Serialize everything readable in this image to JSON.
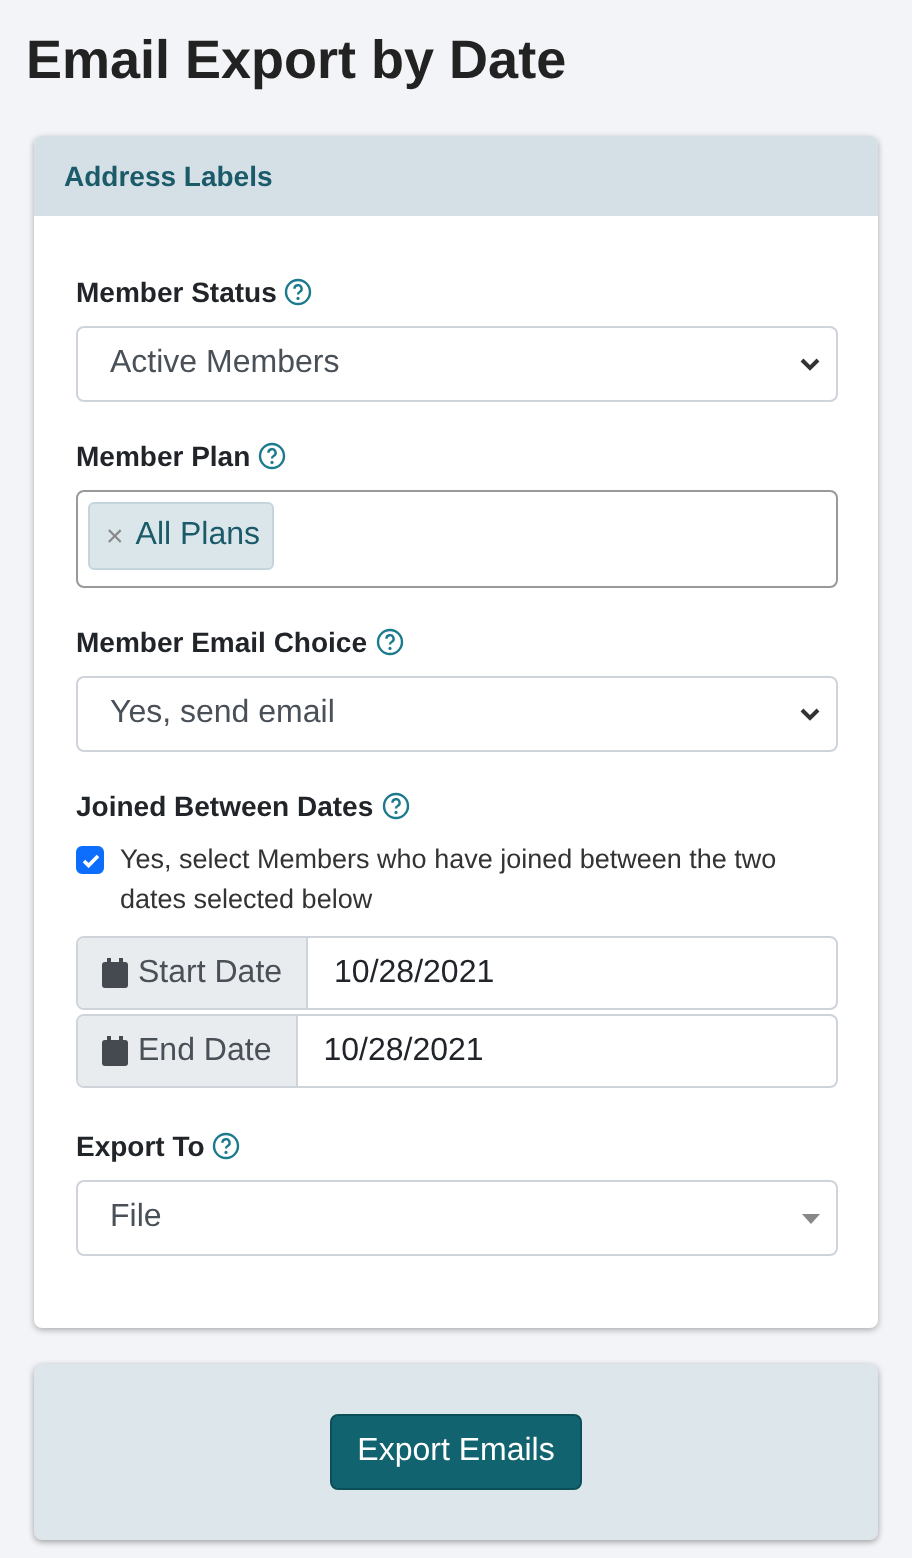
{
  "title": "Email Export by Date",
  "card": {
    "header": "Address Labels",
    "fields": [
      {
        "kind": "select",
        "label": "Member Status",
        "value": "Active Members"
      },
      {
        "kind": "tags",
        "label": "Member Plan",
        "tags": [
          {
            "remove": "×",
            "label": "All Plans"
          }
        ]
      },
      {
        "kind": "select",
        "label": "Member Email Choice",
        "value": "Yes, send email"
      },
      {
        "kind": "dates",
        "label": "Joined Between Dates",
        "checkbox": {
          "label": "Yes, select Members who have joined between the two dates selected below",
          "checked": true
        },
        "dates": [
          {
            "label": "Start Date",
            "value": "10/28/2021"
          },
          {
            "label": "End Date",
            "value": "10/28/2021"
          }
        ]
      },
      {
        "kind": "combobox",
        "label": "Export To",
        "value": "File"
      }
    ]
  },
  "footer": {
    "button": "Export Emails"
  }
}
